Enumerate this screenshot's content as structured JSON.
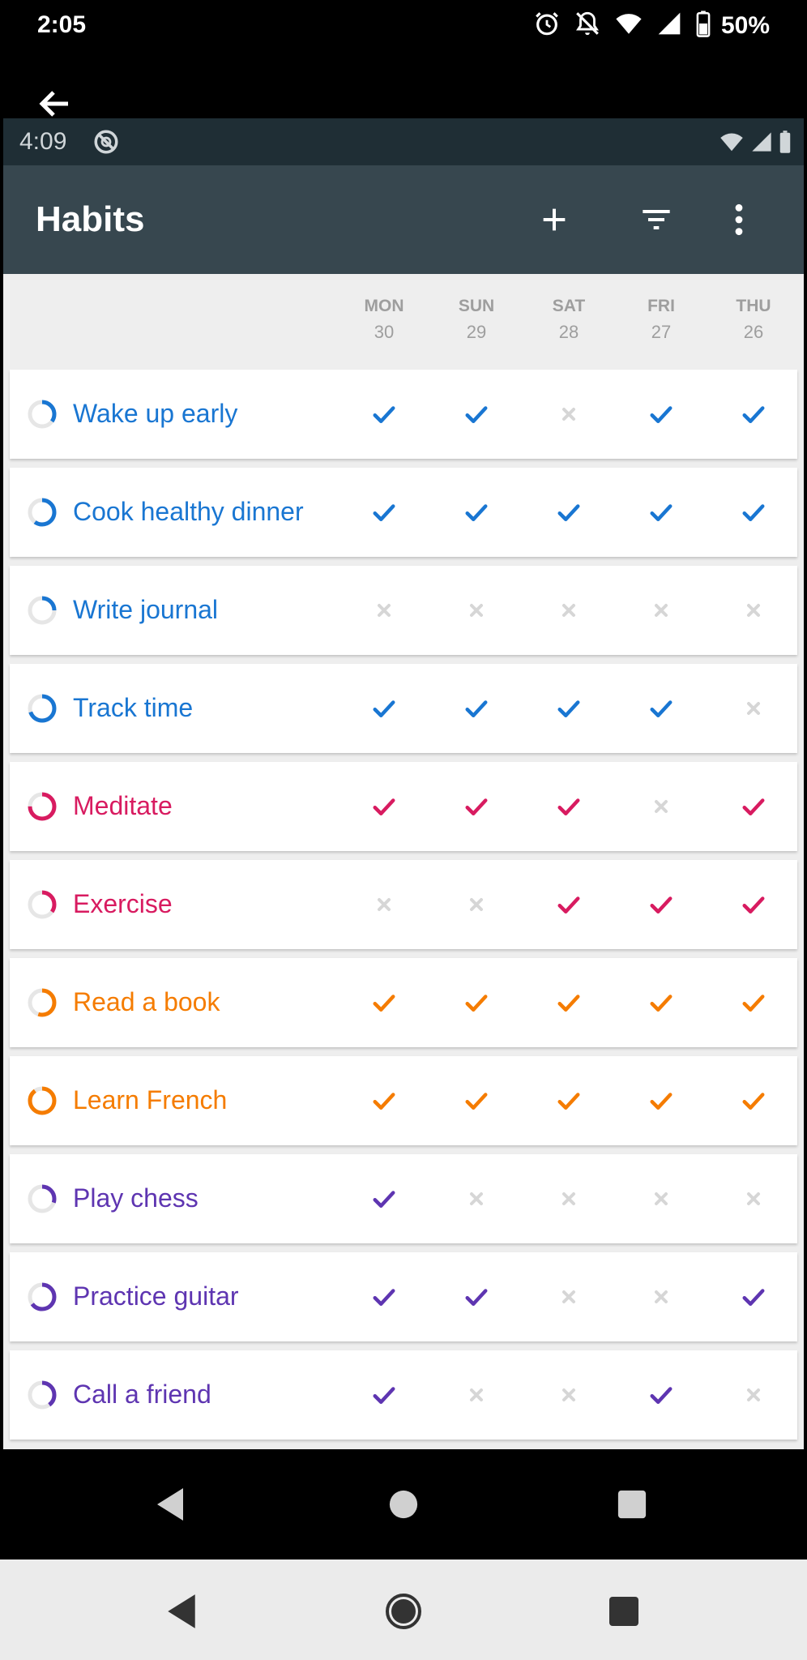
{
  "outer_status": {
    "time": "2:05",
    "battery": "50%"
  },
  "inner_status": {
    "time": "4:09"
  },
  "appbar": {
    "title": "Habits"
  },
  "colors": {
    "blue": "#1976d2",
    "pink": "#d81b60",
    "orange": "#f57c00",
    "purple": "#5e35b1",
    "off": "#d6d6d6"
  },
  "days": [
    {
      "dow": "MON",
      "date": "30"
    },
    {
      "dow": "SUN",
      "date": "29"
    },
    {
      "dow": "SAT",
      "date": "28"
    },
    {
      "dow": "FRI",
      "date": "27"
    },
    {
      "dow": "THU",
      "date": "26"
    }
  ],
  "habits": [
    {
      "name": "Wake up early",
      "color": "blue",
      "score": 0.35,
      "checks": [
        true,
        true,
        false,
        true,
        true
      ]
    },
    {
      "name": "Cook healthy dinner",
      "color": "blue",
      "score": 0.6,
      "checks": [
        true,
        true,
        true,
        true,
        true
      ]
    },
    {
      "name": "Write journal",
      "color": "blue",
      "score": 0.25,
      "checks": [
        false,
        false,
        false,
        false,
        false
      ]
    },
    {
      "name": "Track time",
      "color": "blue",
      "score": 0.7,
      "checks": [
        true,
        true,
        true,
        true,
        false
      ]
    },
    {
      "name": "Meditate",
      "color": "pink",
      "score": 0.75,
      "checks": [
        true,
        true,
        true,
        false,
        true
      ]
    },
    {
      "name": "Exercise",
      "color": "pink",
      "score": 0.35,
      "checks": [
        false,
        false,
        true,
        true,
        true
      ]
    },
    {
      "name": "Read a book",
      "color": "orange",
      "score": 0.55,
      "checks": [
        true,
        true,
        true,
        true,
        true
      ]
    },
    {
      "name": "Learn French",
      "color": "orange",
      "score": 0.9,
      "checks": [
        true,
        true,
        true,
        true,
        true
      ]
    },
    {
      "name": "Play chess",
      "color": "purple",
      "score": 0.3,
      "checks": [
        true,
        false,
        false,
        false,
        false
      ]
    },
    {
      "name": "Practice guitar",
      "color": "purple",
      "score": 0.65,
      "checks": [
        true,
        true,
        false,
        false,
        true
      ]
    },
    {
      "name": "Call a friend",
      "color": "purple",
      "score": 0.4,
      "checks": [
        true,
        false,
        false,
        true,
        false
      ]
    }
  ]
}
